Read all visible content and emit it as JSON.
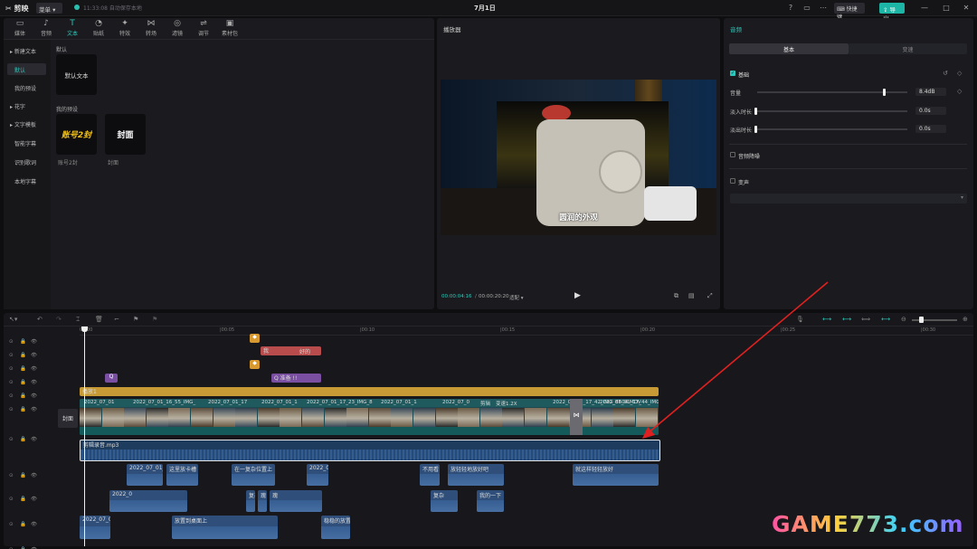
{
  "app": {
    "logo": "剪映",
    "menu_label": "菜单",
    "save_status": "11:33:08 自动保存本地",
    "title": "7月1日",
    "shortcut_label": "快捷键",
    "export_label": "导出"
  },
  "toolbar": [
    {
      "icon": "media-icon",
      "glyph": "▭",
      "label": "媒体"
    },
    {
      "icon": "audio-icon",
      "glyph": "♪",
      "label": "音频"
    },
    {
      "icon": "text-icon",
      "glyph": "T",
      "label": "文本"
    },
    {
      "icon": "sticker-icon",
      "glyph": "◔",
      "label": "贴纸"
    },
    {
      "icon": "effects-icon",
      "glyph": "✦",
      "label": "特效"
    },
    {
      "icon": "transition-icon",
      "glyph": "⋈",
      "label": "转场"
    },
    {
      "icon": "filter-icon",
      "glyph": "◎",
      "label": "滤镜"
    },
    {
      "icon": "adjust-icon",
      "glyph": "⇌",
      "label": "调节"
    },
    {
      "icon": "material-pack-icon",
      "glyph": "▣",
      "label": "素材包"
    }
  ],
  "sidebar": [
    {
      "label": "新建文本",
      "active": false,
      "caret": true
    },
    {
      "label": "默认",
      "active": true,
      "caret": false
    },
    {
      "label": "我的预设",
      "active": false,
      "caret": false
    },
    {
      "label": "花字",
      "active": false,
      "caret": true
    },
    {
      "label": "文字模板",
      "active": false,
      "caret": true
    },
    {
      "label": "智能字幕",
      "active": false,
      "caret": false
    },
    {
      "label": "识别歌词",
      "active": false,
      "caret": false
    },
    {
      "label": "本地字幕",
      "active": false,
      "caret": false
    }
  ],
  "library": {
    "default_heading": "默认",
    "default_tile": "默认文本",
    "preset_heading": "我的预设",
    "presets": [
      {
        "text": "账号2封",
        "caption": "账号2封"
      },
      {
        "text": "封面",
        "caption": "封面"
      }
    ]
  },
  "player": {
    "title": "播放器",
    "subtitle": "圆润的外观",
    "time_current": "00:00:04:16",
    "time_total": "00:00:20:20",
    "ratio": "适配"
  },
  "inspector": {
    "title": "音频",
    "tabs": [
      "基本",
      "变速"
    ],
    "section_basic": "基础",
    "volume_label": "音量",
    "volume_value": "8.4dB",
    "fade_in_label": "淡入时长",
    "fade_in_value": "0.0s",
    "fade_out_label": "淡出时长",
    "fade_out_value": "0.0s",
    "denoise_label": "音频降噪",
    "voice_change_label": "变声"
  },
  "timeline": {
    "ruler": [
      "00:00",
      "|00:05",
      "|00:10",
      "|00:15",
      "|00:20",
      "|00:25",
      "|00:30"
    ],
    "cover_label": "封面",
    "text_clips": [
      "我",
      "好的",
      "Q 准备 !!"
    ],
    "yellow_track_label": "播放1",
    "video_labels": [
      "2022_07_01",
      "2022_07_01_16_55_IMG_",
      "2022_07_01_17",
      "2022_07_01_1",
      "2022_07_01_17_23_IMG_8",
      "2022_07_01_1",
      "2022_07_0",
      "剪辑",
      "变速1.2X",
      "2022_07_01_17_42_IMG_8604.MOV",
      "2022_07_01_17_44_IMG_8"
    ],
    "selected_audio_label": "剪辑录音.mp3",
    "audio_row1": [
      "2022_07_01_1",
      "这里放卡槽",
      "在一复杂位置上",
      "2022_07",
      "不用看",
      "放轻轻地放好吧",
      "就这样轻轻放好"
    ],
    "audio_row2": [
      "2022_0",
      "复杂的东西",
      "瑰",
      "瑰",
      "复杂",
      "我的一下",
      "手机充电器"
    ],
    "audio_row3": [
      "2022_07_01",
      "放置到桌面上",
      "稳稳的放置"
    ]
  },
  "watermark": "GAME773.com"
}
